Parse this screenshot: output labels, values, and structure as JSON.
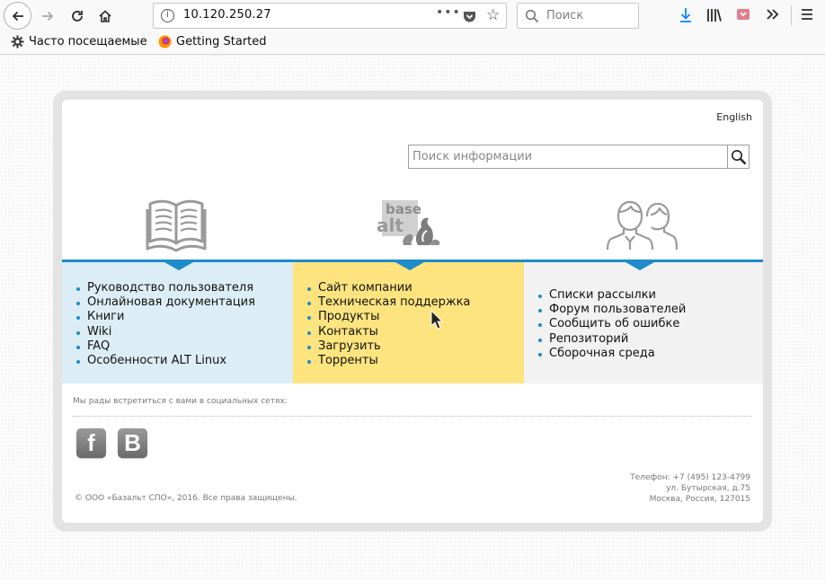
{
  "browser": {
    "url": "10.120.250.27",
    "search_placeholder": "Поиск",
    "bookmarks": [
      "Часто посещаемые",
      "Getting Started"
    ]
  },
  "site": {
    "lang_link": "English",
    "search_placeholder": "Поиск информации",
    "logo_text_top": "base",
    "logo_text_bottom": "alt",
    "columns": {
      "docs": [
        "Руководство пользователя",
        "Онлайновая документация",
        "Книги",
        "Wiki",
        "FAQ",
        "Особенности ALT Linux"
      ],
      "company": [
        "Сайт компании",
        "Техническая поддержка",
        "Продукты",
        "Контакты",
        "Загрузить",
        "Торренты"
      ],
      "community": [
        "Списки рассылки",
        "Форум пользователей",
        "Сообщить об ошибке",
        "Репозиторий",
        "Сборочная среда"
      ]
    },
    "social_title": "Мы рады встретиться с вами в социальных сетях:",
    "social": [
      {
        "name": "facebook",
        "glyph": "f"
      },
      {
        "name": "vkontakte",
        "glyph": "B"
      }
    ],
    "copyright": "© ООО «Базальт СПО», 2016. Все права защищены.",
    "contacts": [
      "Телефон: +7 (495) 123-4799",
      "ул. Бутырская, д.75",
      "Москва, Россия, 127015"
    ]
  },
  "colors": {
    "accent": "#1d8cc8",
    "docs_bg": "#dcedf5",
    "company_bg": "#fde47f",
    "community_bg": "#f2f2f2"
  }
}
